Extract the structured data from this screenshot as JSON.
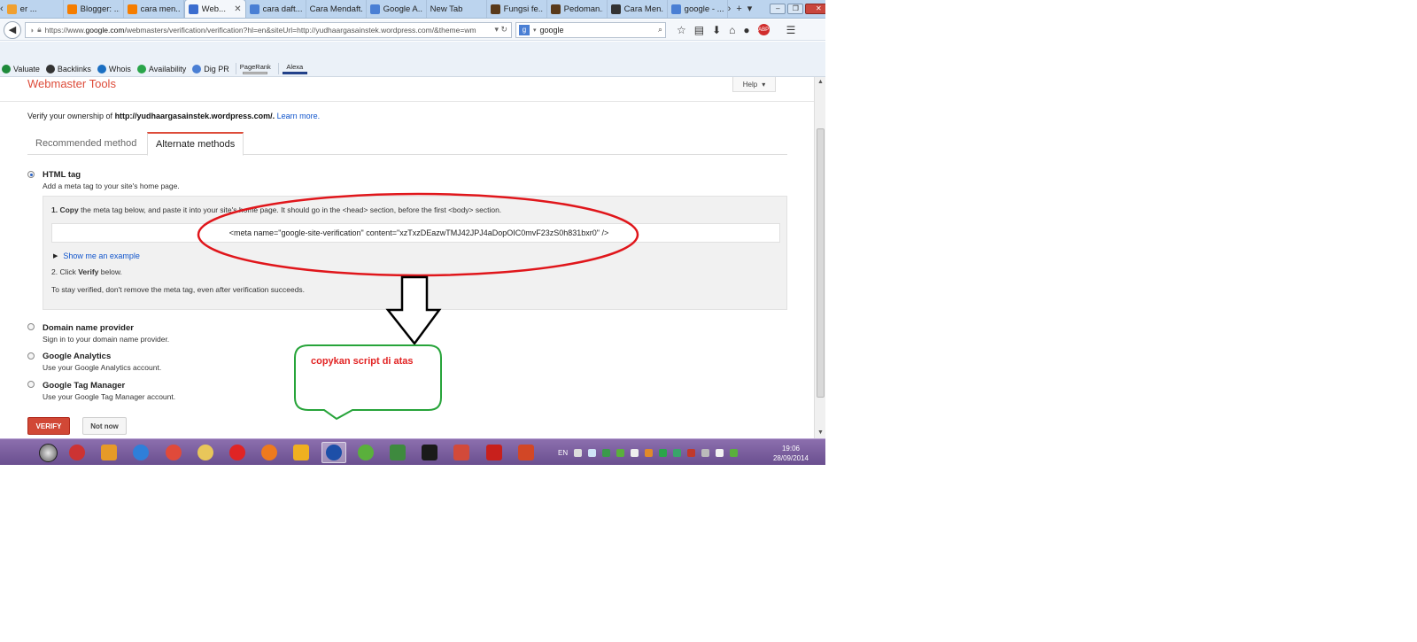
{
  "browser": {
    "tabs": [
      {
        "title": "er ...",
        "color": "#f0a030"
      },
      {
        "title": "Blogger: ...",
        "color": "#f57d00"
      },
      {
        "title": "cara men...",
        "color": "#f57d00"
      },
      {
        "title": "Web...",
        "color": "#3b6dcf",
        "active": true
      },
      {
        "title": "cara daft...",
        "color": "#4a7fd4"
      },
      {
        "title": "Cara Mendaft...",
        "color": ""
      },
      {
        "title": "Google A...",
        "color": "#4a7fd4"
      },
      {
        "title": "New Tab",
        "color": ""
      },
      {
        "title": "Fungsi fe...",
        "color": "#5a3a1a"
      },
      {
        "title": "Pedoman...",
        "color": "#5a3a1a"
      },
      {
        "title": "Cara Men...",
        "color": "#333"
      },
      {
        "title": "google - ...",
        "color": "#4a7fd4"
      }
    ],
    "tab_scroll_left": "‹",
    "tab_scroll_right": "›",
    "new_tab": "+",
    "tab_list": "▾",
    "url_prefix": "https://www.",
    "url_domain": "google.com",
    "url_rest": "/webmasters/verification/verification?hl=en&siteUrl=http://yudhaargasainstek.wordpress.com/&theme=wm",
    "search_value": "google",
    "seo_toolbar": [
      {
        "label": "Valuate",
        "icon": "dollar-icon",
        "color": "#1e8a3a"
      },
      {
        "label": "Backlinks",
        "icon": "backlinks-icon",
        "color": "#333"
      },
      {
        "label": "Whois",
        "icon": "globe-icon",
        "color": "#1b6fc2"
      },
      {
        "label": "Availability",
        "icon": "search-icon",
        "color": "#2aa54a"
      },
      {
        "label": "Dig PR",
        "icon": "network-icon",
        "color": "#4a7fd4"
      }
    ],
    "pagerank_label": "PageRank",
    "alexa_label": "Alexa"
  },
  "page": {
    "title": "Webmaster Tools",
    "help_label": "Help",
    "verify_prefix": "Verify your ownership of ",
    "site_url": "http://yudhaargasainstek.wordpress.com/.",
    "learn_more": "Learn more.",
    "tab_recommended": "Recommended method",
    "tab_alternate": "Alternate methods",
    "html_tag_title": "HTML tag",
    "html_tag_desc": "Add a meta tag to your site's home page.",
    "step1_num": "1. Copy",
    "step1_text": " the meta tag below, and paste it into your site's home page. It should go in the <head> section, before the first <body> section.",
    "meta_tag": "<meta name=\"google-site-verification\" content=\"xzTxzDEazwTMJ42JPJ4aDopOIC0mvF23zS0h831bxr0\" />",
    "show_example": "Show me an example",
    "step2_pre": "2. Click ",
    "step2_bold": "Verify",
    "step2_post": " below.",
    "stay_verified": "To stay verified, don't remove the meta tag, even after verification succeeds.",
    "options": [
      {
        "title": "Domain name provider",
        "desc": "Sign in to your domain name provider."
      },
      {
        "title": "Google Analytics",
        "desc": "Use your Google Analytics account."
      },
      {
        "title": "Google Tag Manager",
        "desc": "Use your Google Tag Manager account."
      }
    ],
    "verify_button": "VERIFY",
    "not_now_button": "Not now"
  },
  "annotation": {
    "callout_text": "copykan script di atas",
    "ellipse_color": "#e0161b",
    "bubble_color": "#27a43a",
    "arrow_color": "#000000"
  },
  "taskbar": {
    "apps": [
      {
        "name": "ccleaner-icon",
        "color": "#cc3333"
      },
      {
        "name": "media-player-icon",
        "color": "#e69a28"
      },
      {
        "name": "internet-explorer-icon",
        "color": "#2f7fd9"
      },
      {
        "name": "chrome-icon",
        "color": "#e04a3a"
      },
      {
        "name": "file-explorer-icon",
        "color": "#e8c65a"
      },
      {
        "name": "opera-icon",
        "color": "#e02424"
      },
      {
        "name": "firefox-icon",
        "color": "#ee7a1e"
      },
      {
        "name": "winamp-icon",
        "color": "#f0b020"
      },
      {
        "name": "firefox-active-icon",
        "color": "#1d4fa8",
        "active": true
      },
      {
        "name": "utorrent-icon",
        "color": "#5ab03c"
      },
      {
        "name": "monitor-icon",
        "color": "#3e8a3e"
      },
      {
        "name": "terminal-icon",
        "color": "#1a1a1a"
      },
      {
        "name": "book-icon",
        "color": "#d24a3a"
      },
      {
        "name": "acrobat-icon",
        "color": "#c8201c"
      },
      {
        "name": "powerpoint-icon",
        "color": "#d24726"
      }
    ],
    "language": "EN",
    "time": "19:06",
    "date": "28/09/2014"
  }
}
